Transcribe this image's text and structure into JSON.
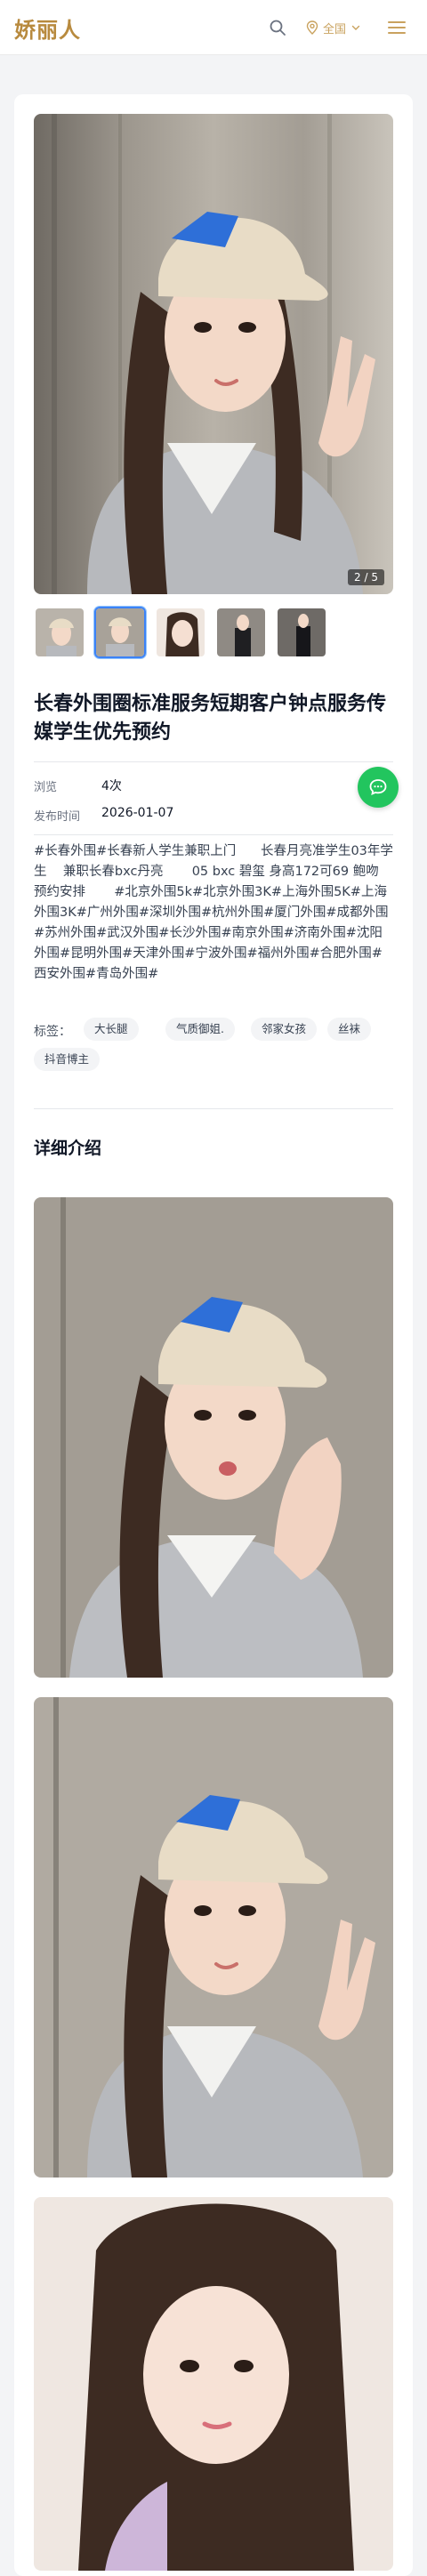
{
  "header": {
    "logo": "娇丽人",
    "region_label": "全国",
    "icons": {
      "search": "search-icon",
      "region": "location-pin-icon",
      "chevron": "chevron-down-icon",
      "menu": "menu-icon",
      "chat": "chat-icon"
    },
    "colors": {
      "brand": "#b88a3e",
      "accent": "#c9a25e",
      "chat": "#22c55e",
      "active_thumb": "#3b82f6"
    }
  },
  "gallery": {
    "counter": "2 / 5",
    "thumbnail_count": 5,
    "active_thumbnail": 2
  },
  "post": {
    "title": "长春外围圈标准服务短期客户钟点服务传媒学生优先预约",
    "meta": [
      {
        "label": "浏览",
        "value": "4次"
      },
      {
        "label": "发布时间",
        "value": "2026-01-07"
      }
    ],
    "description": "#长春外围#长春新人学生兼职上门      长春月亮准学生03年学生    兼职长春bxc丹亮       05 bxc 碧玺 身高172可69 鲍吻       预约安排       #北京外围5k#北京外围3K#上海外围5K#上海外围3K#广州外围#深圳外围#杭州外围#厦门外围#成都外围#苏州外围#武汉外围#长沙外围#南京外围#济南外围#沈阳外围#昆明外围#天津外围#宁波外围#福州外围#合肥外围#西安外围#青岛外围#",
    "tags_label": "标签：",
    "tags": [
      "大长腿",
      "气质御姐.",
      "邻家女孩",
      "丝袜",
      "抖音博主"
    ]
  },
  "details": {
    "section_title": "详细介绍",
    "photo_count": 3
  }
}
